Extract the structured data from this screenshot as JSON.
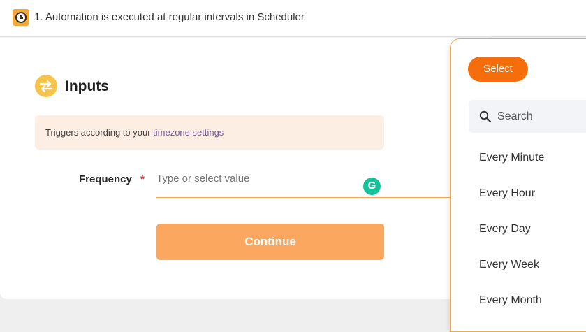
{
  "header": {
    "title": "1. Automation is executed at regular intervals in Scheduler"
  },
  "inputs": {
    "title": "Inputs",
    "info_prefix": "Triggers according to your ",
    "info_link": "timezone settings",
    "frequency_label": "Frequency",
    "required_mark": "*",
    "frequency_placeholder": "Type or select value",
    "continue_label": "Continue"
  },
  "dropdown": {
    "select_label": "Select",
    "search_placeholder": "Search",
    "options": [
      "Every Minute",
      "Every Hour",
      "Every Day",
      "Every Week",
      "Every Month"
    ]
  },
  "colors": {
    "accent_orange": "#f66e0b",
    "continue_button": "#fba760",
    "info_background": "#fdeee3",
    "link_purple": "#7b5aa6",
    "grammarly_green": "#15c39a"
  }
}
